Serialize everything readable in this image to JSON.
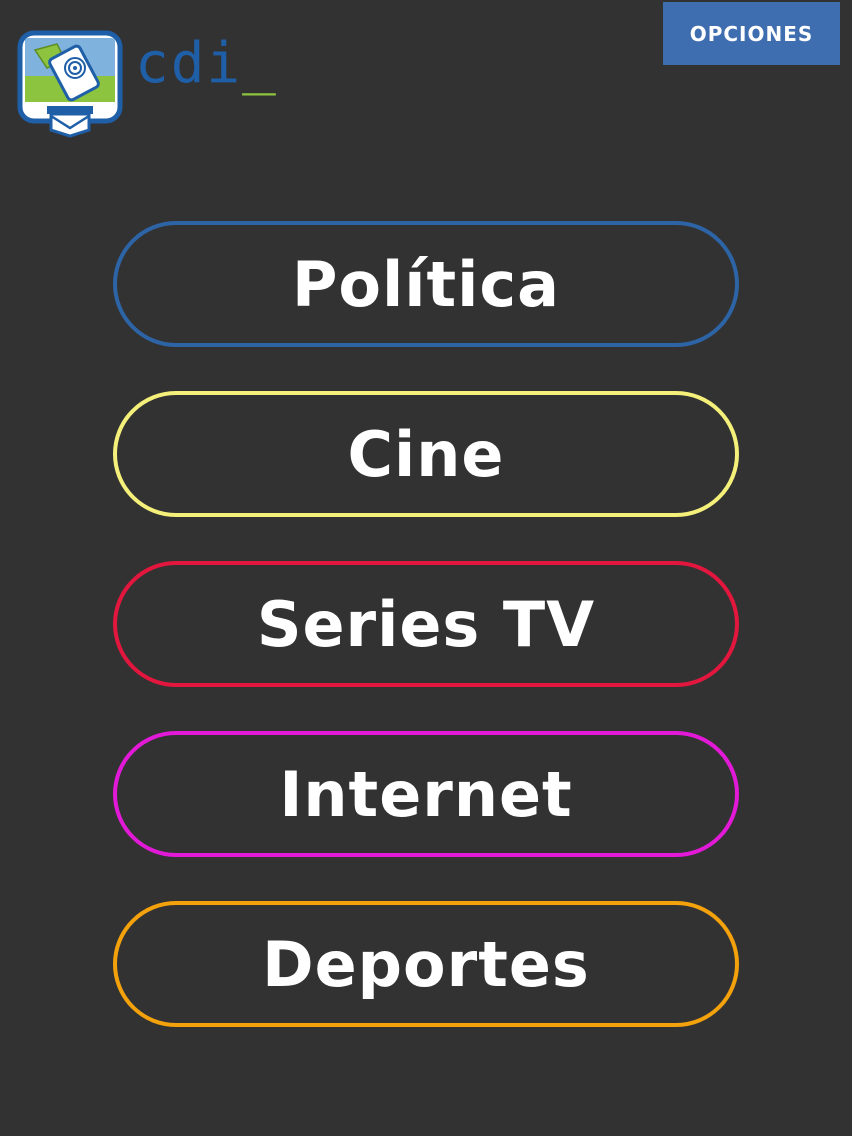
{
  "header": {
    "logo": {
      "text": "cdi",
      "cursor": "_",
      "icon": "cdi-logo-icon",
      "text_color": "#1f5fa8",
      "accent_color": "#8dc43f"
    },
    "options_label": "OPCIONES",
    "options_color": "#3f6eb0"
  },
  "menu": {
    "items": [
      {
        "label": "Política",
        "color": "#2d64a6"
      },
      {
        "label": "Cine",
        "color": "#f4f07a"
      },
      {
        "label": "Series TV",
        "color": "#e3173e"
      },
      {
        "label": "Internet",
        "color": "#e21ad8"
      },
      {
        "label": "Deportes",
        "color": "#f4a20c"
      }
    ]
  },
  "background_color": "#333233"
}
